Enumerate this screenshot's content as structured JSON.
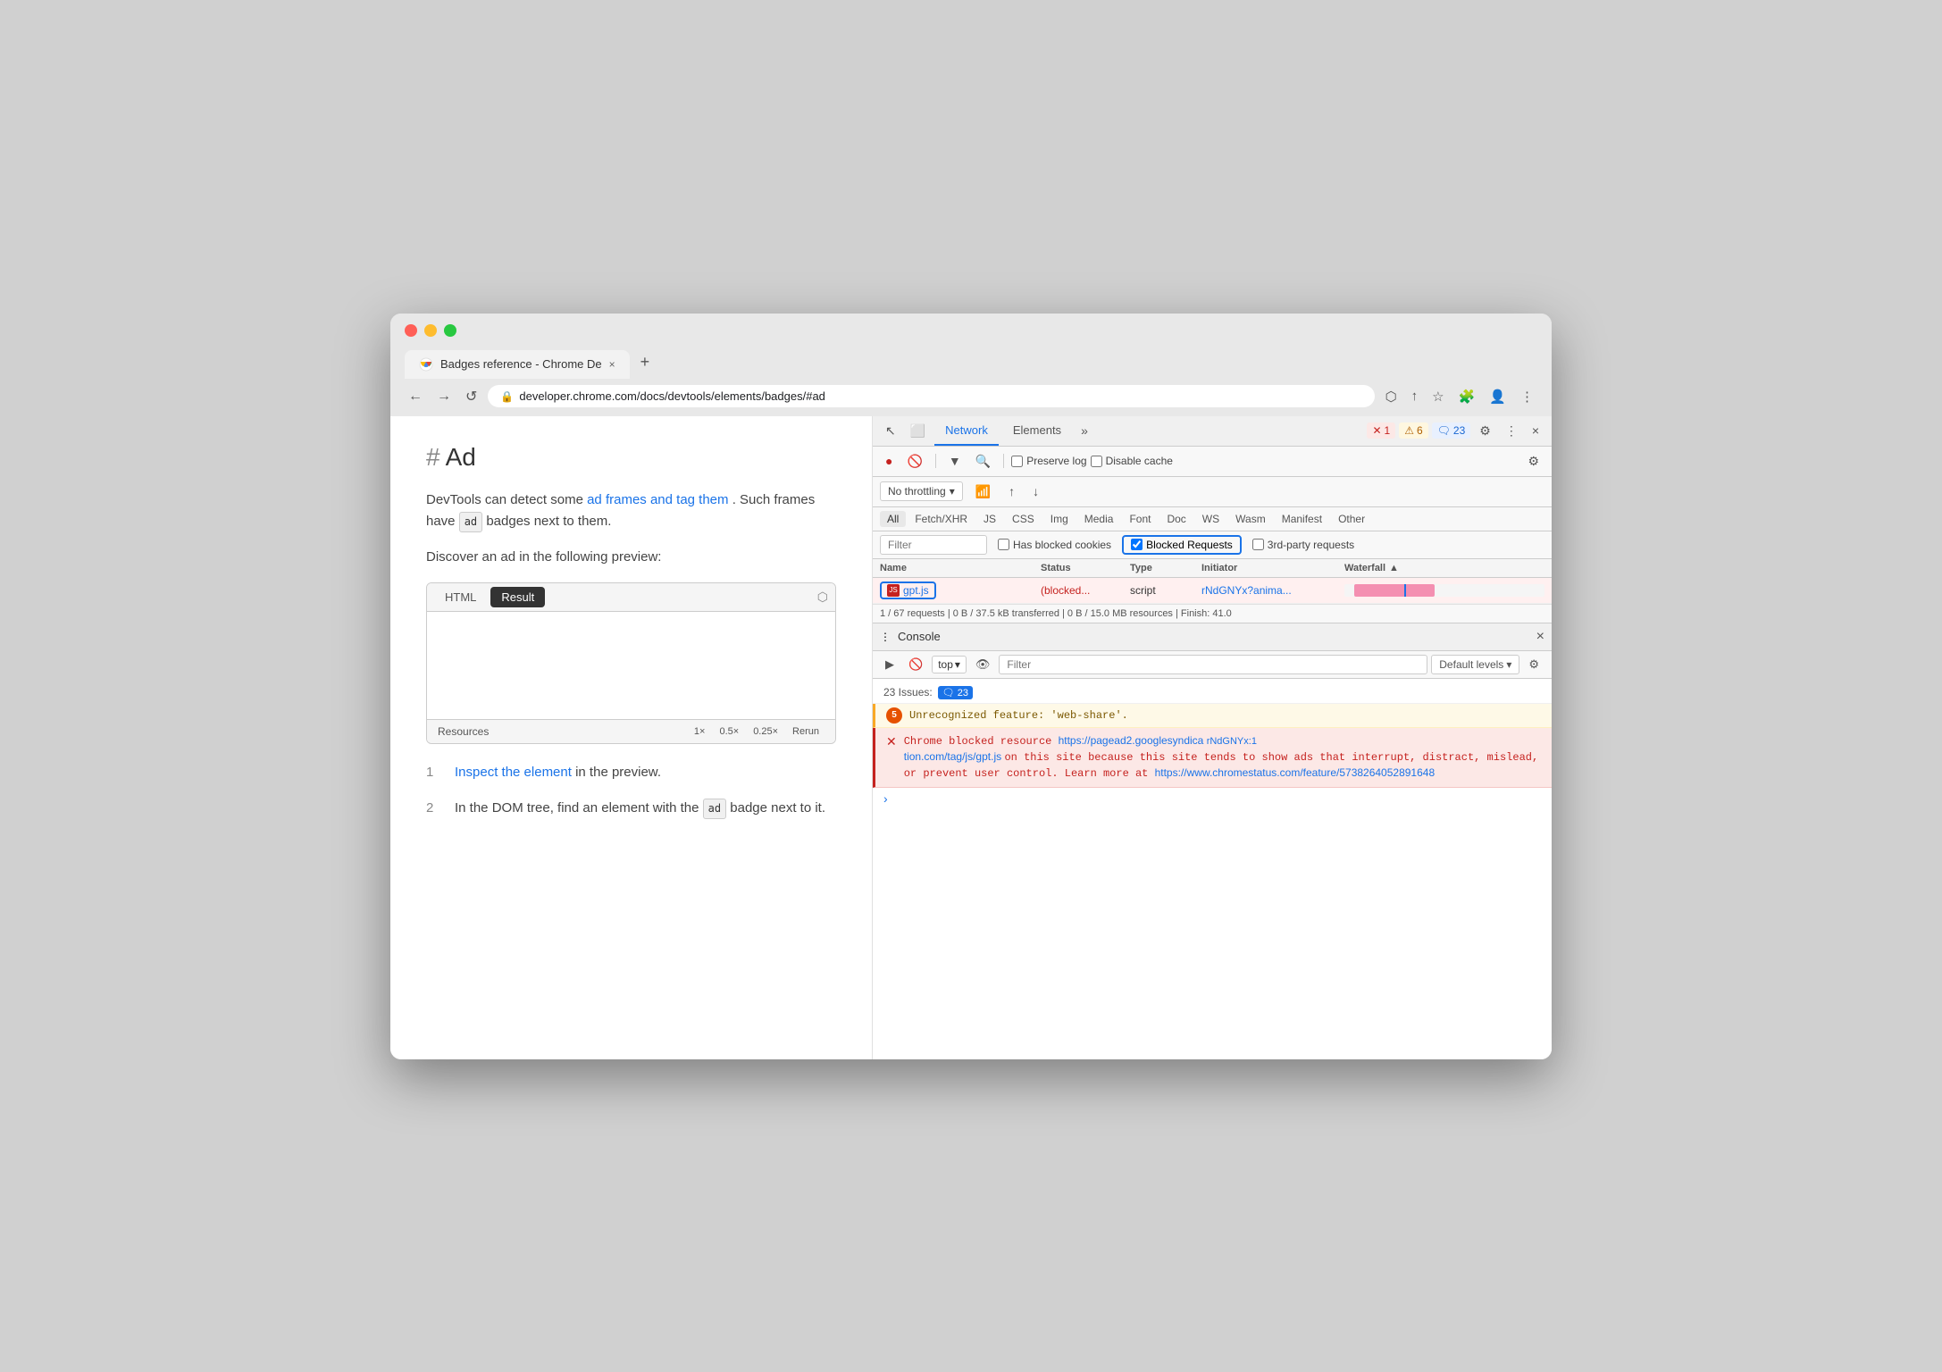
{
  "browser": {
    "traffic_lights": [
      "red",
      "yellow",
      "green"
    ],
    "tab": {
      "label": "Badges reference - Chrome De",
      "close_icon": "×"
    },
    "new_tab_icon": "+",
    "address_bar": {
      "url": "developer.chrome.com/docs/devtools/elements/badges/#ad",
      "back_label": "←",
      "forward_label": "→",
      "reload_label": "↺"
    }
  },
  "page": {
    "heading_hash": "#",
    "heading_text": "Ad",
    "paragraph1": "DevTools can detect some ",
    "link1": "ad frames and tag them",
    "paragraph1b": ". Such frames have ",
    "badge_ad": "ad",
    "paragraph1c": " badges next to them.",
    "paragraph2": "Discover an ad in the following preview:",
    "preview_tabs": [
      "HTML",
      "Result"
    ],
    "preview_active_tab": "Result",
    "preview_footer_label": "Resources",
    "preview_footer_btns": [
      "1×",
      "0.5×",
      "0.25×",
      "Rerun"
    ],
    "steps": [
      {
        "num": "1",
        "link": "Inspect the element",
        "text": " in the preview."
      },
      {
        "num": "2",
        "text1": "In the DOM tree, find an element with the ",
        "badge": "ad",
        "text2": " badge next to it."
      }
    ]
  },
  "devtools": {
    "tabs": [
      "Elements",
      "Network"
    ],
    "active_tab": "Network",
    "more_icon": "»",
    "badges": {
      "error": "1",
      "warning": "6",
      "info": "23"
    },
    "settings_icon": "⚙",
    "more_btn": "⋮",
    "close_icon": "×",
    "toolbar": {
      "record_active": true,
      "block_icon": "🚫",
      "filter_icon": "▼",
      "search_icon": "🔍",
      "preserve_log_label": "Preserve log",
      "disable_cache_label": "Disable cache",
      "settings_icon": "⚙"
    },
    "filter_row": {
      "throttle_label": "No throttling",
      "wifi_icon": "wifi",
      "upload_icon": "↑",
      "download_icon": "↓"
    },
    "filter_tabs": [
      "All",
      "Fetch/XHR",
      "JS",
      "CSS",
      "Img",
      "Media",
      "Font",
      "Doc",
      "WS",
      "Wasm",
      "Manifest",
      "Other"
    ],
    "active_filter_tab": "All",
    "filter_checkboxes": {
      "has_blocked_cookies": "Has blocked cookies",
      "blocked_requests": "Blocked Requests",
      "third_party": "3rd-party requests"
    },
    "table": {
      "headers": [
        "Name",
        "Status",
        "Type",
        "Initiator",
        "Waterfall"
      ],
      "rows": [
        {
          "name": "gpt.js",
          "status": "(blocked...",
          "type": "script",
          "initiator": "rNdGNYx?anima...",
          "has_waterfall": true
        }
      ]
    },
    "status_bar": "1 / 67 requests  |  0 B / 37.5 kB transferred  |  0 B / 15.0 MB resources  |  Finish: 41.0",
    "console": {
      "title": "Console",
      "close_icon": "×",
      "toolbar": {
        "run_icon": "▶",
        "block_icon": "🚫",
        "top_label": "top",
        "eye_icon": "👁",
        "filter_placeholder": "Filter",
        "default_levels_label": "Default levels",
        "settings_icon": "⚙"
      },
      "issues_count": "23 Issues:",
      "issues_badge": "🗨 23",
      "warning_message": {
        "badge_count": "5",
        "text": "Unrecognized feature: 'web-share'."
      },
      "error_message": {
        "main_text": "Chrome blocked resource ",
        "link1": "https://pagead2.googlesyndica",
        "link1_right": "rNdGNYx:1",
        "text2": "tion.com/tag/js/gpt.js",
        "text3": " on this site because this site tends to show ads that interrupt, distract, mislead, or prevent user control. Learn more at ",
        "link2": "https://www.chromestatus.com/feature/5738264052891648"
      },
      "prompt_chevron": ">"
    }
  }
}
